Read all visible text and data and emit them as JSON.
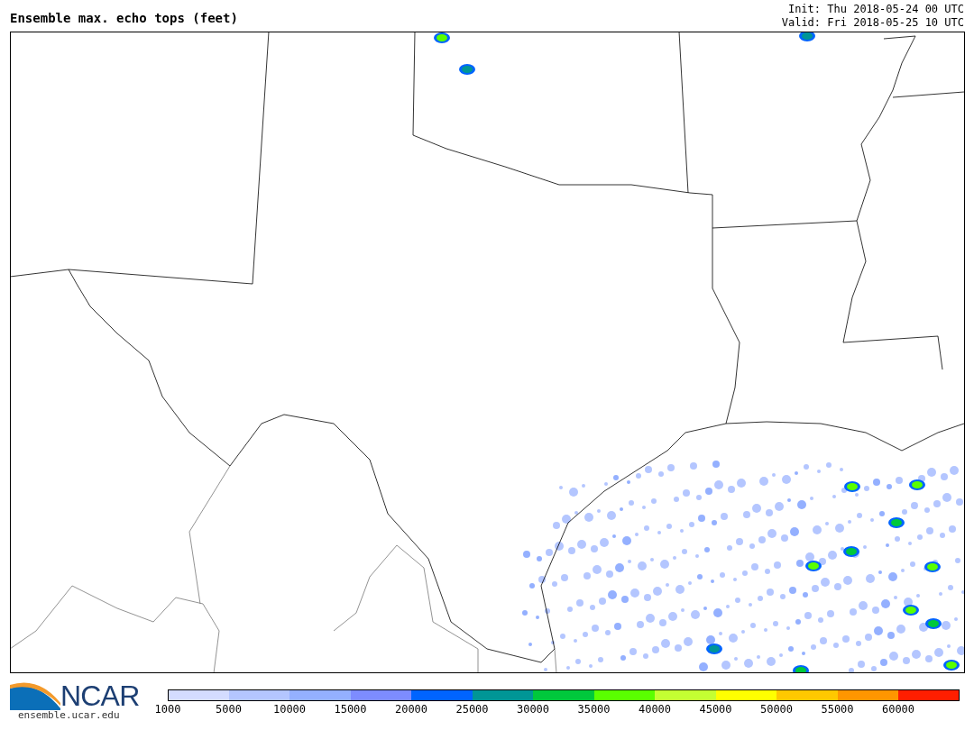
{
  "title": "Ensemble max. echo tops (feet)",
  "init": "Init: Thu 2018-05-24 00 UTC",
  "valid": "Valid: Fri 2018-05-25 10 UTC",
  "logo": {
    "text": "NCAR",
    "url": "ensemble.ucar.edu"
  },
  "colorbar": [
    {
      "label": "1000",
      "color": "#d4dcff"
    },
    {
      "label": "5000",
      "color": "#b4c6ff"
    },
    {
      "label": "10000",
      "color": "#94b0ff"
    },
    {
      "label": "15000",
      "color": "#7d8cff"
    },
    {
      "label": "20000",
      "color": "#0064ff"
    },
    {
      "label": "25000",
      "color": "#009696"
    },
    {
      "label": "30000",
      "color": "#00c83c"
    },
    {
      "label": "35000",
      "color": "#5aff00"
    },
    {
      "label": "40000",
      "color": "#c4ff32"
    },
    {
      "label": "45000",
      "color": "#ffff00"
    },
    {
      "label": "50000",
      "color": "#ffc800"
    },
    {
      "label": "55000",
      "color": "#ff9600"
    },
    {
      "label": "60000",
      "color": "#ff1e00"
    }
  ]
}
